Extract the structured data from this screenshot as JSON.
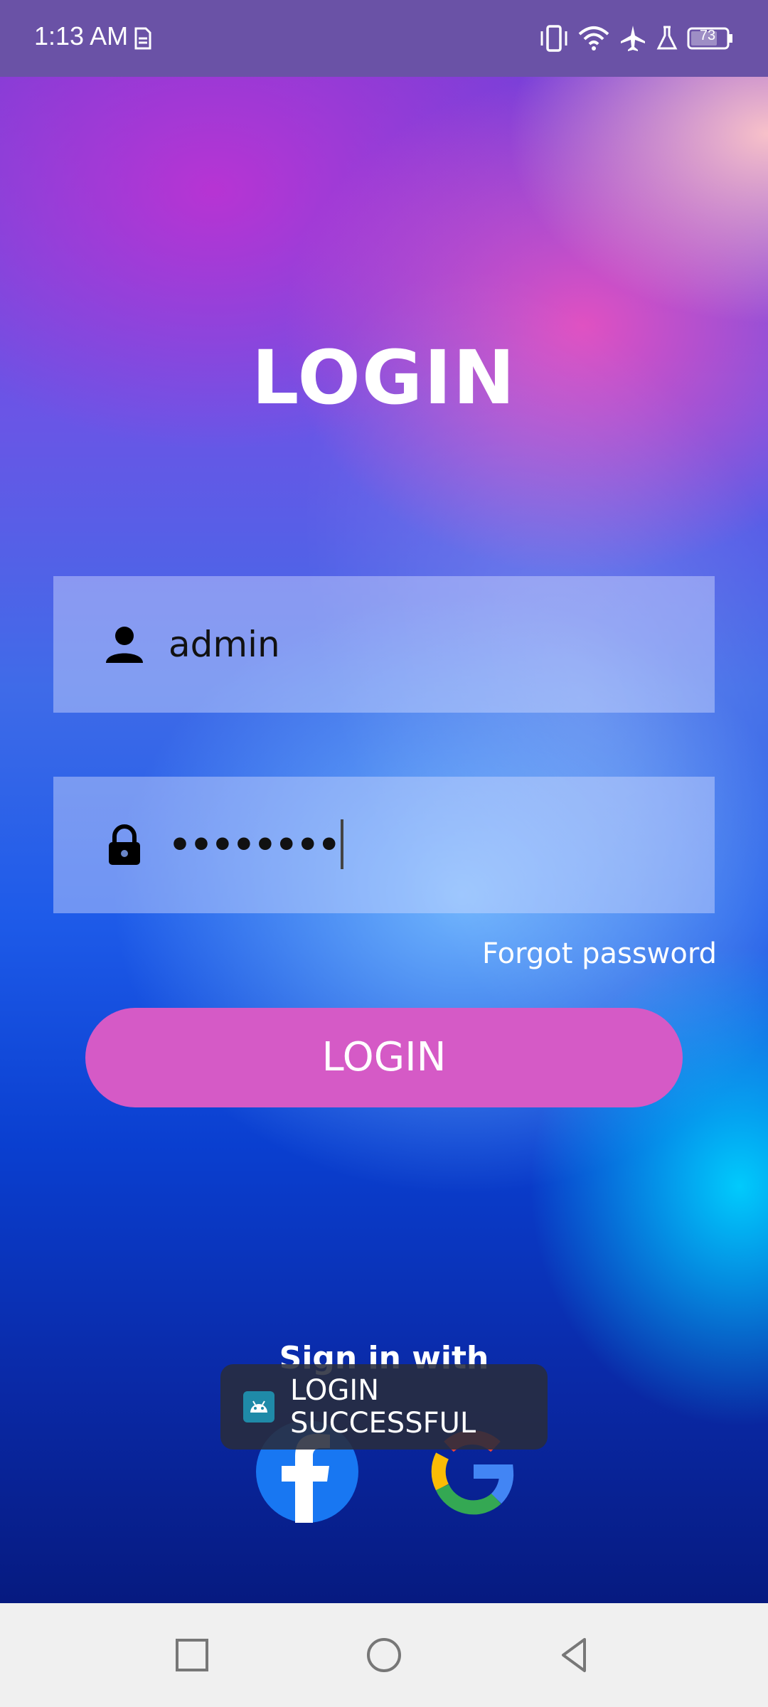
{
  "status_bar": {
    "time": "1:13 AM",
    "battery": "73",
    "icons": [
      "sim-icon",
      "vibrate-icon",
      "wifi-icon",
      "airplane-icon",
      "flask-icon",
      "battery-icon"
    ]
  },
  "login_screen": {
    "title": "LOGIN",
    "username_value": "admin",
    "password_value": "••••••••",
    "forgot_password": "Forgot password",
    "login_button": "LOGIN",
    "sign_in_with": "Sign in with",
    "social": [
      "facebook-icon",
      "google-icon"
    ]
  },
  "toast": {
    "message": "LOGIN SUCCESSFUL"
  },
  "colors": {
    "status_bar": "#6a52a6",
    "button": "#d55ac6",
    "field_bg": "rgba(210,220,255,0.45)"
  }
}
